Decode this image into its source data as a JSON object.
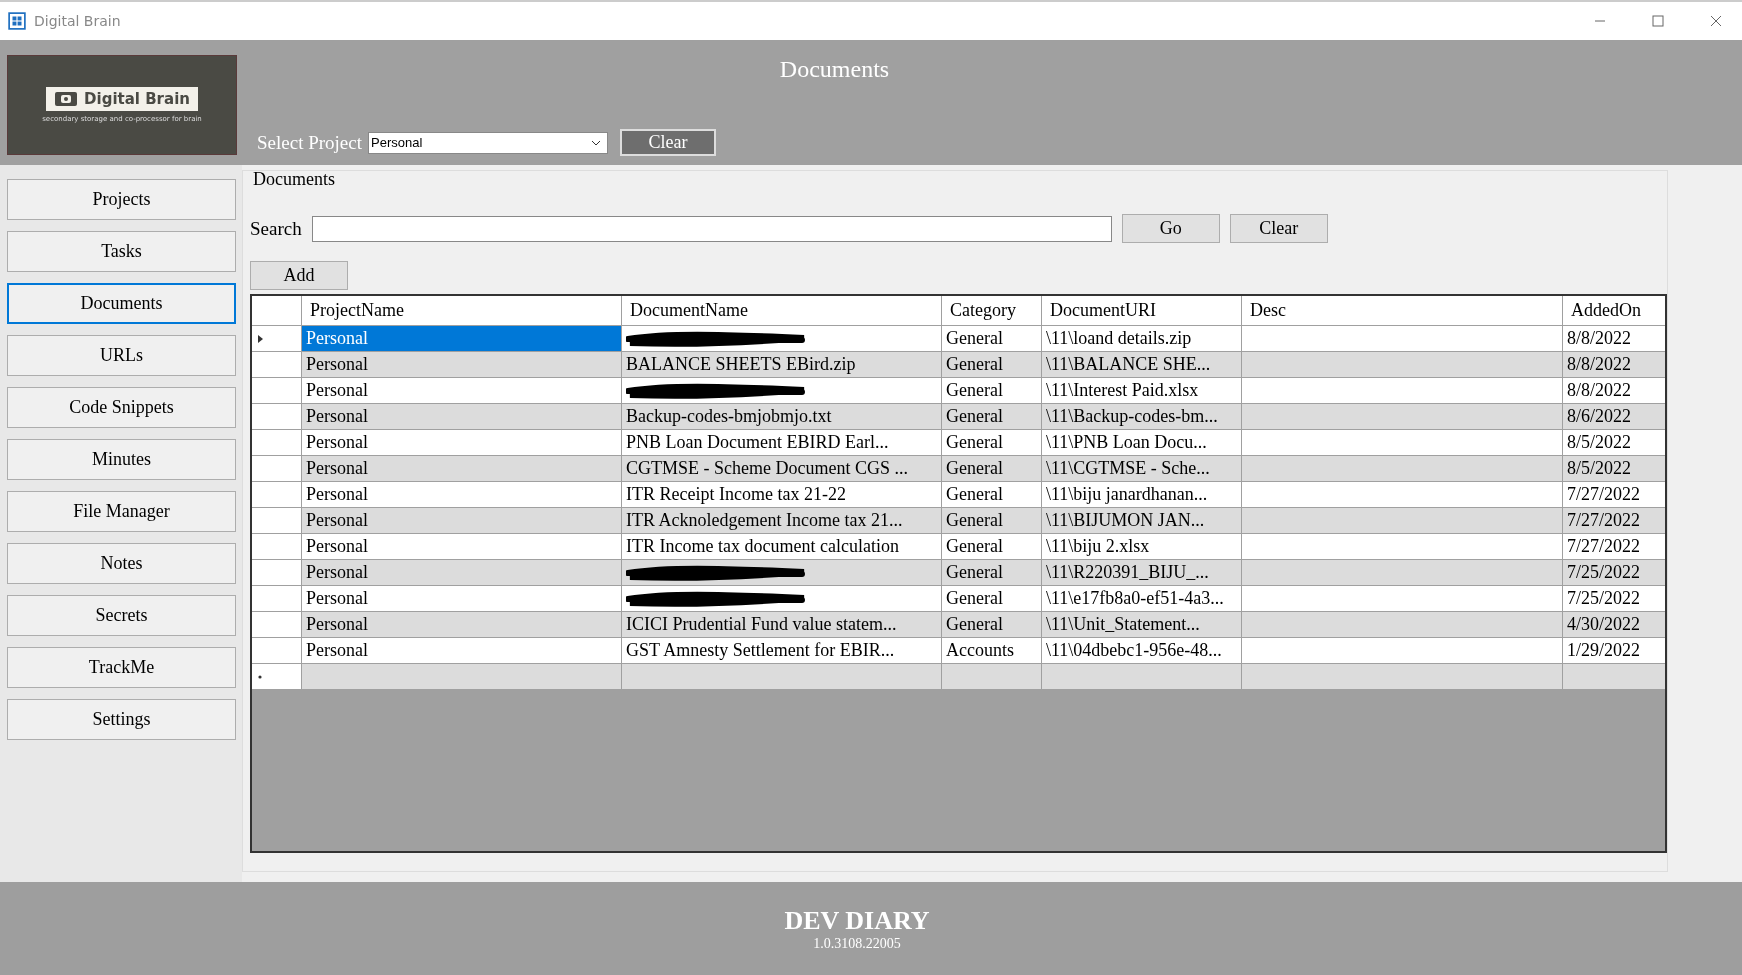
{
  "window": {
    "title": "Digital Brain"
  },
  "logo": {
    "name": "Digital Brain",
    "tagline": "secondary storage and co-processor for brain"
  },
  "header": {
    "title": "Documents",
    "select_label": "Select Project",
    "select_value": "Personal",
    "clear_button": "Clear"
  },
  "sidebar": {
    "items": [
      {
        "label": "Projects",
        "selected": false
      },
      {
        "label": "Tasks",
        "selected": false
      },
      {
        "label": "Documents",
        "selected": true
      },
      {
        "label": "URLs",
        "selected": false
      },
      {
        "label": "Code Snippets",
        "selected": false
      },
      {
        "label": "Minutes",
        "selected": false
      },
      {
        "label": "File Manager",
        "selected": false
      },
      {
        "label": "Notes",
        "selected": false
      },
      {
        "label": "Secrets",
        "selected": false
      },
      {
        "label": "TrackMe",
        "selected": false
      },
      {
        "label": "Settings",
        "selected": false
      }
    ]
  },
  "group": {
    "title": "Documents",
    "search_label": "Search",
    "go_button": "Go",
    "clear_button": "Clear",
    "add_button": "Add"
  },
  "table": {
    "columns": [
      "ProjectName",
      "DocumentName",
      "Category",
      "DocumentURI",
      "Desc",
      "AddedOn"
    ],
    "rows": [
      {
        "selected": true,
        "project": "Personal",
        "redacted": true,
        "category": "General",
        "uri": "\\11\\loand details.zip",
        "added": "8/8/2022"
      },
      {
        "selected": false,
        "project": "Personal",
        "document": "BALANCE SHEETS EBird.zip",
        "redacted": false,
        "category": "General",
        "uri": "\\11\\BALANCE SHE...",
        "added": "8/8/2022"
      },
      {
        "selected": false,
        "project": "Personal",
        "redacted": true,
        "category": "General",
        "uri": "\\11\\Interest Paid.xlsx",
        "added": "8/8/2022"
      },
      {
        "selected": false,
        "project": "Personal",
        "document": "Backup-codes-bmjobmjo.txt",
        "redacted": false,
        "category": "General",
        "uri": "\\11\\Backup-codes-bm...",
        "added": "8/6/2022"
      },
      {
        "selected": false,
        "project": "Personal",
        "document": "PNB Loan Document  EBIRD Earl...",
        "redacted": false,
        "category": "General",
        "uri": "\\11\\PNB Loan Docu...",
        "added": "8/5/2022"
      },
      {
        "selected": false,
        "project": "Personal",
        "document": "CGTMSE - Scheme Document CGS ...",
        "redacted": false,
        "category": "General",
        "uri": "\\11\\CGTMSE - Sche...",
        "added": "8/5/2022"
      },
      {
        "selected": false,
        "project": "Personal",
        "document": "ITR Receipt Income tax 21-22",
        "redacted": false,
        "category": "General",
        "uri": "\\11\\biju janardhanan...",
        "added": "7/27/2022"
      },
      {
        "selected": false,
        "project": "Personal",
        "document": "ITR Acknoledgement Income tax 21...",
        "redacted": false,
        "category": "General",
        "uri": "\\11\\BIJUMON JAN...",
        "added": "7/27/2022"
      },
      {
        "selected": false,
        "project": "Personal",
        "document": "ITR Income tax document calculation",
        "redacted": false,
        "category": "General",
        "uri": "\\11\\biju 2.xlsx",
        "added": "7/27/2022"
      },
      {
        "selected": false,
        "project": "Personal",
        "redacted": true,
        "category": "General",
        "uri": "\\11\\R220391_BIJU_...",
        "added": "7/25/2022"
      },
      {
        "selected": false,
        "project": "Personal",
        "redacted": true,
        "category": "General",
        "uri": "\\11\\e17fb8a0-ef51-4a3...",
        "added": "7/25/2022"
      },
      {
        "selected": false,
        "project": "Personal",
        "document": "ICICI Prudential Fund value statem...",
        "redacted": false,
        "category": "General",
        "uri": "\\11\\Unit_Statement...",
        "added": "4/30/2022"
      },
      {
        "selected": false,
        "project": "Personal",
        "document": "GST Amnesty Settlement for EBIR...",
        "redacted": false,
        "category": "Accounts",
        "uri": "\\11\\04dbebc1-956e-48...",
        "added": "1/29/2022"
      }
    ]
  },
  "footer": {
    "title": "DEV DIARY",
    "version": "1.0.3108.22005"
  }
}
